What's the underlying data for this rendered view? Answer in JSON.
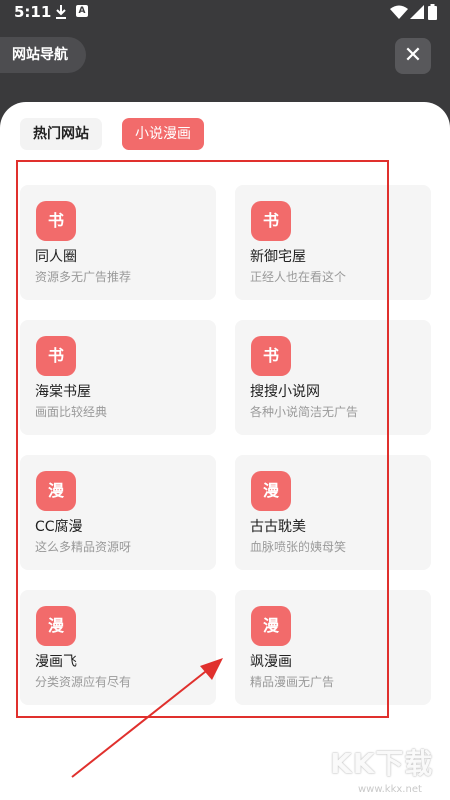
{
  "status_bar": {
    "time": "5:11",
    "a_label": "A"
  },
  "header": {
    "title": "网站导航",
    "close_symbol": "✕"
  },
  "tabs": [
    {
      "label": "热门网站",
      "active": false
    },
    {
      "label": "小说漫画",
      "active": true
    }
  ],
  "cards": [
    {
      "icon": "书",
      "name": "同人圈",
      "desc": "资源多无广告推荐"
    },
    {
      "icon": "书",
      "name": "新御宅屋",
      "desc": "正经人也在看这个"
    },
    {
      "icon": "书",
      "name": "海棠书屋",
      "desc": "画面比较经典"
    },
    {
      "icon": "书",
      "name": "搜搜小说网",
      "desc": "各种小说简洁无广告"
    },
    {
      "icon": "漫",
      "name": "CC腐漫",
      "desc": "这么多精品资源呀"
    },
    {
      "icon": "漫",
      "name": "古古耽美",
      "desc": "血脉喷张的姨母笑"
    },
    {
      "icon": "漫",
      "name": "漫画飞",
      "desc": "分类资源应有尽有"
    },
    {
      "icon": "漫",
      "name": "飒漫画",
      "desc": "精品漫画无广告"
    }
  ],
  "watermark": {
    "brand": "KK下载",
    "url": "www.kkx.net"
  },
  "colors": {
    "accent": "#f26b6b",
    "highlight": "#e0302d"
  }
}
